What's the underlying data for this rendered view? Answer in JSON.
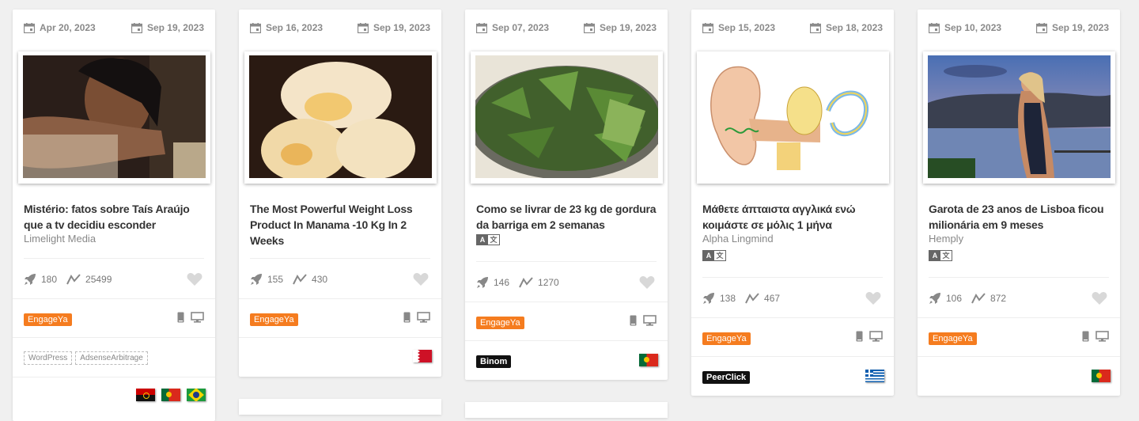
{
  "cards": [
    {
      "start": "Apr 20, 2023",
      "end": "Sep 19, 2023",
      "title": "Mistério: fatos sobre Taís Araújo que a tv decidiu esconder",
      "source": "Limelight Media",
      "launches": "180",
      "trend": "25499",
      "badge": "EngageYa",
      "tags": [
        "WordPress",
        "AdsenseArbitrage"
      ],
      "flags": [
        "angola-flag",
        "portugal-flag",
        "brazil-flag"
      ]
    },
    {
      "start": "Sep 16, 2023",
      "end": "Sep 19, 2023",
      "title": "The Most Powerful Weight Loss Product In Manama -10 Kg In 2 Weeks",
      "launches": "155",
      "trend": "430",
      "badge": "EngageYa",
      "flags": [
        "bahrain-flag"
      ]
    },
    {
      "start": "Sep 07, 2023",
      "end": "Sep 19, 2023",
      "title": "Como se livrar de 23 kg de gordura da barriga em 2 semanas",
      "launches": "146",
      "trend": "1270",
      "badge": "EngageYa",
      "network": "Binom",
      "flags": [
        "portugal-flag"
      ]
    },
    {
      "start": "Sep 15, 2023",
      "end": "Sep 18, 2023",
      "title": "Μάθετε άπταιστα αγγλικά ενώ κοιμάστε σε μόλις 1 μήνα",
      "source": "Alpha Lingmind",
      "launches": "138",
      "trend": "467",
      "badge": "EngageYa",
      "network": "PeerClick",
      "flags": [
        "greece-flag"
      ]
    },
    {
      "start": "Sep 10, 2023",
      "end": "Sep 19, 2023",
      "title": "Garota de 23 anos de Lisboa ficou milionária em 9 meses",
      "source": "Hemply",
      "launches": "106",
      "trend": "872",
      "badge": "EngageYa",
      "flags": [
        "portugal-flag"
      ]
    }
  ],
  "icons": {
    "calendar": "calendar-icon",
    "rocket": "rocket-icon",
    "trend": "trend-icon",
    "heart": "heart-icon",
    "mobile": "mobile-icon",
    "desktop": "desktop-icon",
    "translate": "translate-icon"
  },
  "colors": {
    "badge": "#f57c1f",
    "network": "#111111"
  }
}
